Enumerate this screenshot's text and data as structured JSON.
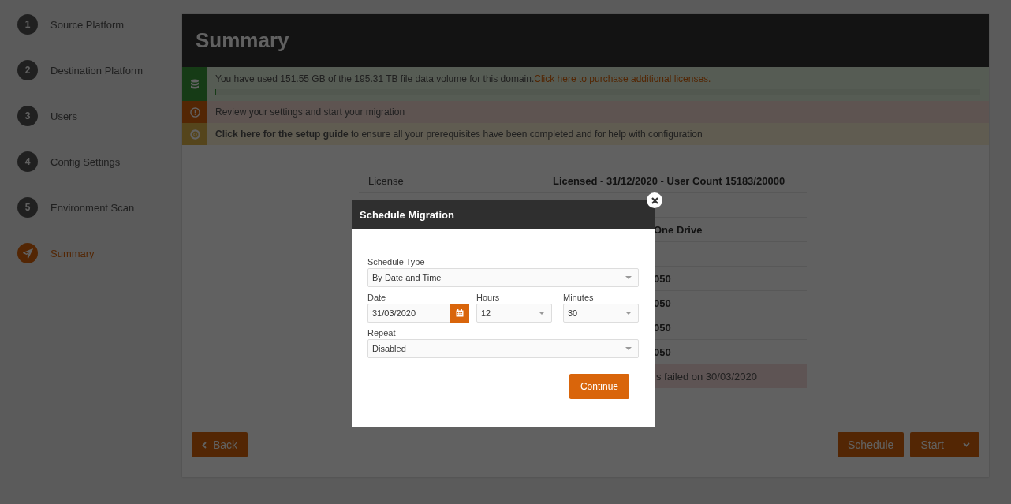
{
  "steps": [
    {
      "number": "1",
      "label": "Source Platform",
      "selected": false,
      "kind": "number"
    },
    {
      "number": "2",
      "label": "Destination Platform",
      "selected": false,
      "kind": "number"
    },
    {
      "number": "3",
      "label": "Users",
      "selected": false,
      "kind": "number"
    },
    {
      "number": "4",
      "label": "Config Settings",
      "selected": false,
      "kind": "number"
    },
    {
      "number": "5",
      "label": "Environment Scan",
      "selected": false,
      "kind": "number"
    },
    {
      "label": "Summary",
      "selected": true,
      "kind": "icon"
    }
  ],
  "page_title": "Summary",
  "alerts": [
    {
      "kind": "usage",
      "text": "You have used 151.55 GB of the 195.31 TB file data volume for this domain.",
      "link": "Click here to purchase additional licenses.",
      "level": 0.001
    },
    {
      "kind": "warning",
      "text": "Review your settings and start your migration"
    },
    {
      "kind": "guide",
      "text": "**Click here for the setup guide** to ensure all your prerequisites have been completed and for help with configuration"
    }
  ],
  "summary_rows": [
    {
      "label": "License",
      "value": "Licensed - 31/12/2020 - User Count 15183/20000",
      "kind": "full"
    },
    {
      "kind": "covered"
    },
    {
      "value": "One Drive",
      "kind": "covered"
    },
    {
      "kind": "covered"
    },
    {
      "value": "050",
      "kind": "covered"
    },
    {
      "value": "050",
      "kind": "covered"
    },
    {
      "value": "050",
      "kind": "covered"
    },
    {
      "value": "050",
      "kind": "covered"
    },
    {
      "value": "s failed on 30/03/2020",
      "kind": "error"
    }
  ],
  "buttons": {
    "back": "Back",
    "schedule": "Schedule",
    "start": "Start"
  },
  "modal": {
    "title": "Schedule Migration",
    "schedule_type": {
      "label": "Schedule Type",
      "value": "By Date and Time"
    },
    "date": {
      "label": "Date",
      "value": "31/03/2020"
    },
    "hours": {
      "label": "Hours",
      "value": "12"
    },
    "minutes": {
      "label": "Minutes",
      "value": "30"
    },
    "repeat": {
      "label": "Repeat",
      "value": "Disabled"
    },
    "continue": "Continue"
  }
}
